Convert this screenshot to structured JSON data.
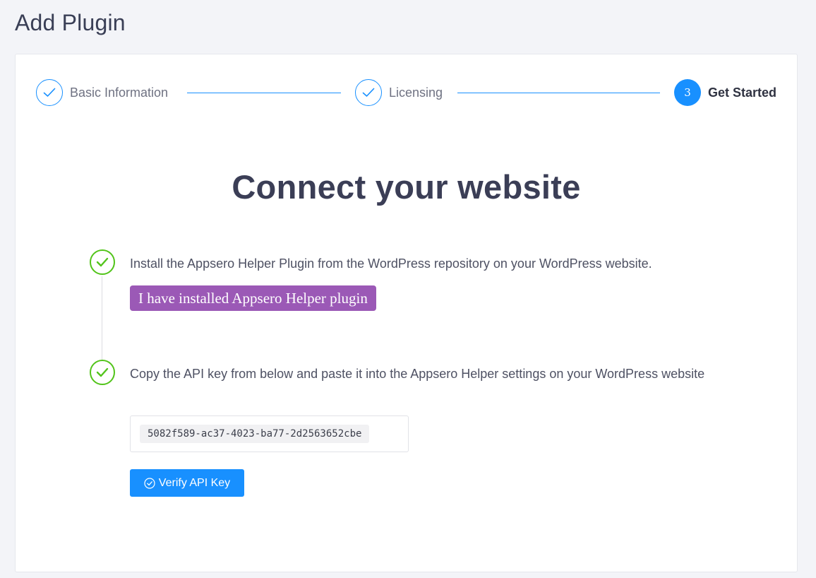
{
  "page": {
    "title": "Add Plugin"
  },
  "stepper": {
    "steps": [
      {
        "label": "Basic Information",
        "status": "done",
        "icon": "check-icon"
      },
      {
        "label": "Licensing",
        "status": "done",
        "icon": "check-icon"
      },
      {
        "label": "Get Started",
        "status": "active",
        "number": "3"
      }
    ]
  },
  "main": {
    "heading": "Connect your website",
    "steps": [
      {
        "text": "Install the Appsero Helper Plugin from the WordPress repository on your WordPress website.",
        "button_label": "I have installed Appsero Helper plugin",
        "icon": "check-circle-icon"
      },
      {
        "text": "Copy the API key from below and paste it into the Appsero Helper settings on your WordPress website",
        "api_key": "5082f589-ac37-4023-ba77-2d2563652cbe",
        "icon": "check-circle-icon"
      }
    ],
    "verify_label": "Verify API Key"
  },
  "colors": {
    "primary": "#1890ff",
    "success": "#52c41a",
    "purple_button": "#9b59b6",
    "background": "#f3f4f8"
  }
}
